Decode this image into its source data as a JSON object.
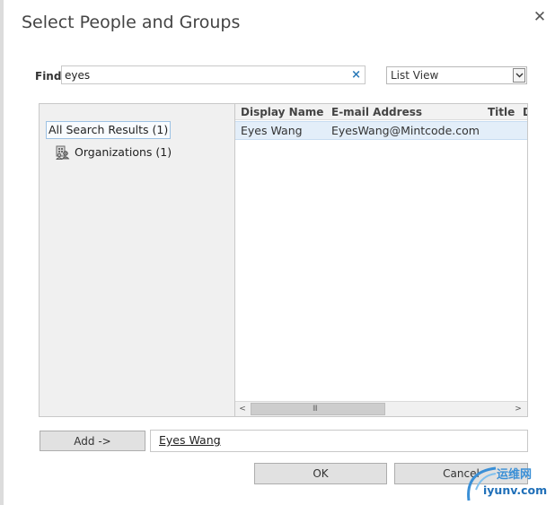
{
  "dialog": {
    "title": "Select People and Groups",
    "close_glyph": "✕"
  },
  "find": {
    "label": "Find",
    "value": "eyes",
    "placeholder": "",
    "clear_glyph": "×"
  },
  "view_select": {
    "selected": "List View"
  },
  "tree": {
    "root_label": "All Search Results (1)",
    "child_label": "Organizations (1)"
  },
  "grid": {
    "columns": [
      "Display Name",
      "E-mail Address",
      "Title",
      "D"
    ],
    "rows": [
      {
        "display_name": "Eyes Wang",
        "email": "EyesWang@Mintcode.com",
        "title": "",
        "d": ""
      }
    ]
  },
  "scrollbar": {
    "left_arrow": "<",
    "right_arrow": ">",
    "grip": "III"
  },
  "add": {
    "label": "Add ->",
    "selected_name": "Eyes Wang",
    "separator": ";"
  },
  "buttons": {
    "ok_label": "OK",
    "cancel_label": "Cancel"
  },
  "watermark": {
    "cn_text": "运维网",
    "url_text": "iyunv.com"
  },
  "colors": {
    "accent": "#2a7ab8",
    "row_selected": "#e3eef9",
    "pane_background": "#f0f0f0"
  }
}
